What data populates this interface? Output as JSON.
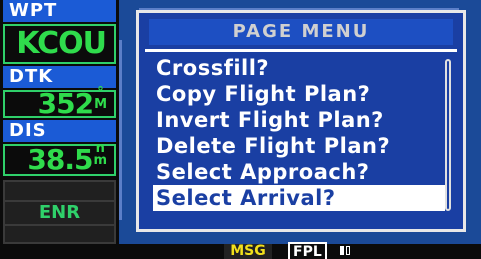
{
  "left_column": {
    "fields": [
      {
        "label": "WPT",
        "value": "KCOU",
        "unit_top": "",
        "unit_bottom": ""
      },
      {
        "label": "DTK",
        "value": "352",
        "unit_top": "°",
        "unit_bottom": "M"
      },
      {
        "label": "DIS",
        "value": "38.5",
        "unit_top": "n",
        "unit_bottom": "m"
      }
    ],
    "mode": "ENR"
  },
  "page_menu": {
    "title": "PAGE MENU",
    "items": [
      {
        "label": "Crossfill?"
      },
      {
        "label": "Copy Flight Plan?"
      },
      {
        "label": "Invert Flight Plan?"
      },
      {
        "label": "Delete Flight Plan?"
      },
      {
        "label": "Select Approach?"
      },
      {
        "label": "Select Arrival?"
      }
    ],
    "selected_index": 5
  },
  "status_bar": {
    "msg": "MSG",
    "page": "FPL"
  },
  "colors": {
    "field_value": "#2fdc4c",
    "label_bg": "#1b5bd6",
    "menu_bg": "#1a3fa3",
    "msg_text": "#f2e01c"
  }
}
